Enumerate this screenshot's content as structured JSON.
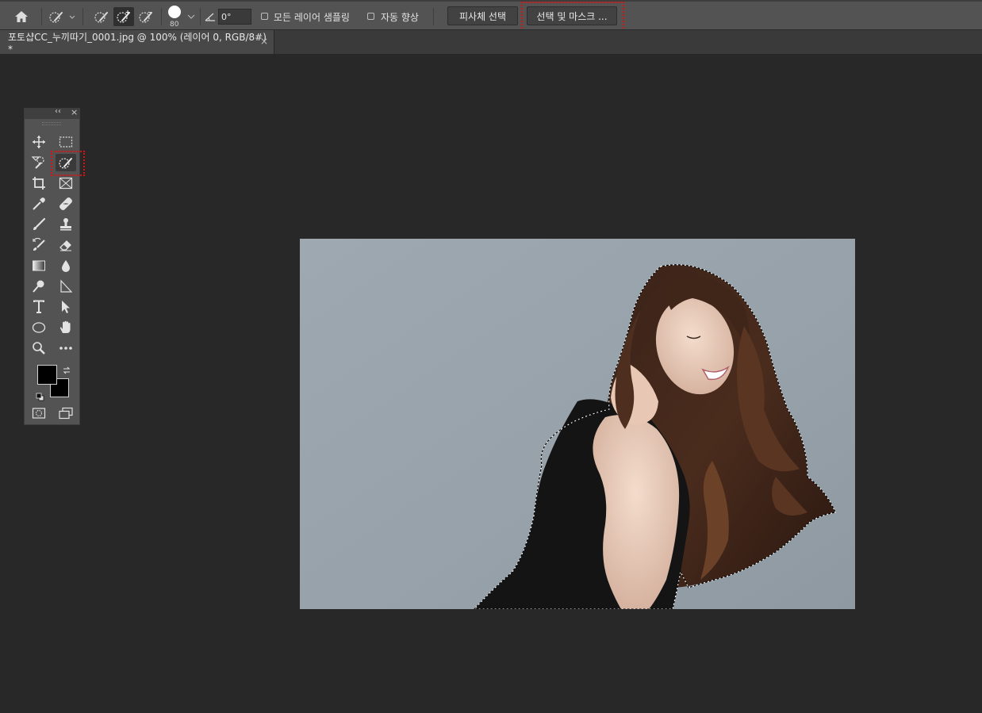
{
  "options_bar": {
    "brush_size": "80",
    "angle_value": "0°",
    "sample_all_layers_label": "모든 레이어 샘플링",
    "auto_enhance_label": "자동 향상",
    "select_subject_label": "피사체 선택",
    "select_and_mask_label": "선택 및 마스크 ..."
  },
  "document_tab": {
    "title": "포토샵CC_누끼따기_0001.jpg @ 100% (레이어 0, RGB/8#) *",
    "close_glyph": "×"
  },
  "toolbox": {
    "collapse_glyph": "‹‹",
    "close_glyph": "×",
    "selected_tool": "quick-selection-tool"
  },
  "colors": {
    "foreground": "#000000",
    "background": "#000000",
    "highlight": "#dd1111"
  }
}
